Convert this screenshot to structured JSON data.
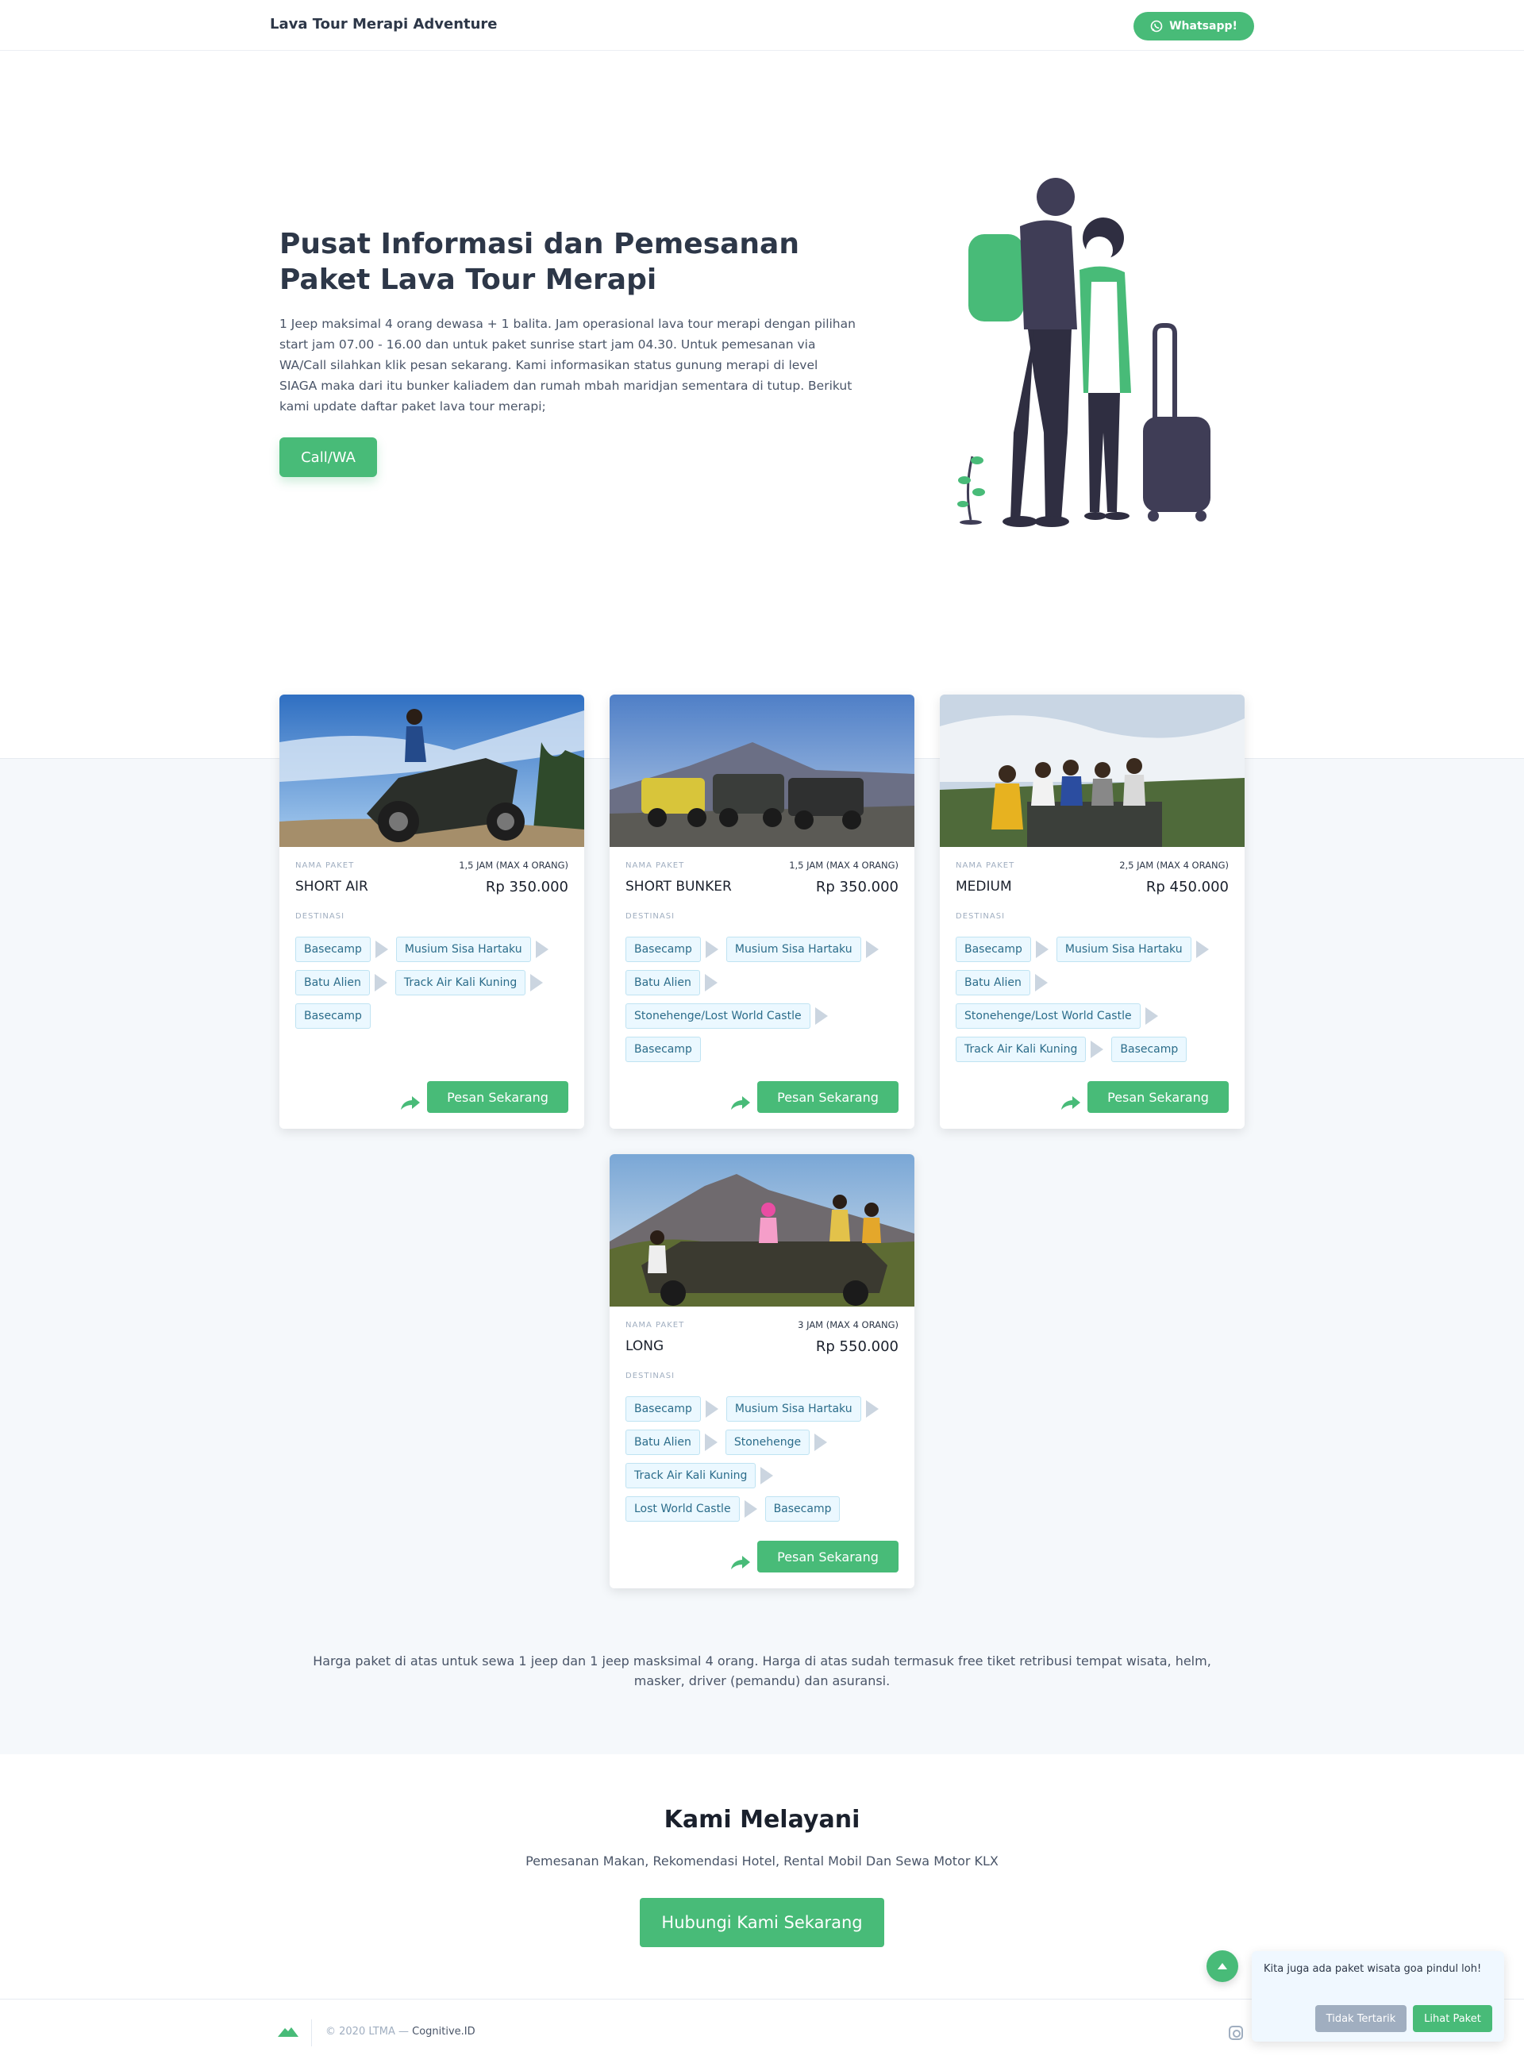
{
  "header": {
    "brand": "Lava Tour Merapi Adventure",
    "whatsapp_label": "Whatsapp!"
  },
  "hero": {
    "title": "Pusat Informasi dan Pemesanan Paket Lava Tour Merapi",
    "description": "1 Jeep maksimal 4 orang dewasa + 1 balita. Jam operasional lava tour merapi dengan pilihan start jam 07.00 - 16.00 dan untuk paket sunrise start jam 04.30. Untuk pemesanan via WA/Call silahkan klik pesan sekarang. Kami informasikan status gunung merapi di level SIAGA maka dari itu bunker kaliadem dan rumah mbah maridjan sementara di tutup. Berikut kami update daftar paket lava tour merapi;",
    "cta_label": "Call/WA"
  },
  "labels": {
    "nama_paket": "NAMA PAKET",
    "destinasi": "DESTINASI",
    "order": "Pesan Sekarang"
  },
  "packages": [
    {
      "name": "SHORT AIR",
      "duration": "1,5 JAM (MAX 4 ORANG)",
      "price": "Rp 350.000",
      "rows": [
        [
          "Basecamp",
          "Musium Sisa Hartaku"
        ],
        [
          "Batu Alien",
          "Track Air Kali Kuning"
        ],
        [
          "Basecamp"
        ]
      ]
    },
    {
      "name": "SHORT BUNKER",
      "duration": "1,5 JAM (MAX 4 ORANG)",
      "price": "Rp 350.000",
      "rows": [
        [
          "Basecamp",
          "Musium Sisa Hartaku"
        ],
        [
          "Batu Alien"
        ],
        [
          "Stonehenge/Lost World Castle"
        ],
        [
          "Basecamp"
        ]
      ]
    },
    {
      "name": "MEDIUM",
      "duration": "2,5 JAM (MAX 4 ORANG)",
      "price": "Rp 450.000",
      "rows": [
        [
          "Basecamp",
          "Musium Sisa Hartaku"
        ],
        [
          "Batu Alien"
        ],
        [
          "Stonehenge/Lost World Castle"
        ],
        [
          "Track Air Kali Kuning",
          "Basecamp"
        ]
      ]
    },
    {
      "name": "LONG",
      "duration": "3 JAM (MAX 4 ORANG)",
      "price": "Rp 550.000",
      "rows": [
        [
          "Basecamp",
          "Musium Sisa Hartaku"
        ],
        [
          "Batu Alien",
          "Stonehenge"
        ],
        [
          "Track Air Kali Kuning"
        ],
        [
          "Lost World Castle",
          "Basecamp"
        ]
      ]
    }
  ],
  "note": "Harga paket di atas untuk sewa 1 jeep dan 1 jeep masksimal 4 orang. Harga di atas sudah termasuk free tiket retribusi tempat wisata, helm, masker, driver (pemandu) dan asuransi.",
  "services": {
    "title": "Kami Melayani",
    "subtitle": "Pemesanan Makan, Rekomendasi Hotel, Rental Mobil Dan Sewa Motor KLX",
    "cta_label": "Hubungi Kami Sekarang"
  },
  "footer": {
    "copyright": "© 2020 LTMA —",
    "link": "Cognitive.ID"
  },
  "popup": {
    "text": "Kita juga ada paket wisata goa pindul loh!",
    "decline": "Tidak Tertarik",
    "accept": "Lihat Paket"
  },
  "colors": {
    "accent": "#48bb78",
    "chip_bg": "#ebf8ff",
    "section_bg": "#f5f8fb"
  }
}
